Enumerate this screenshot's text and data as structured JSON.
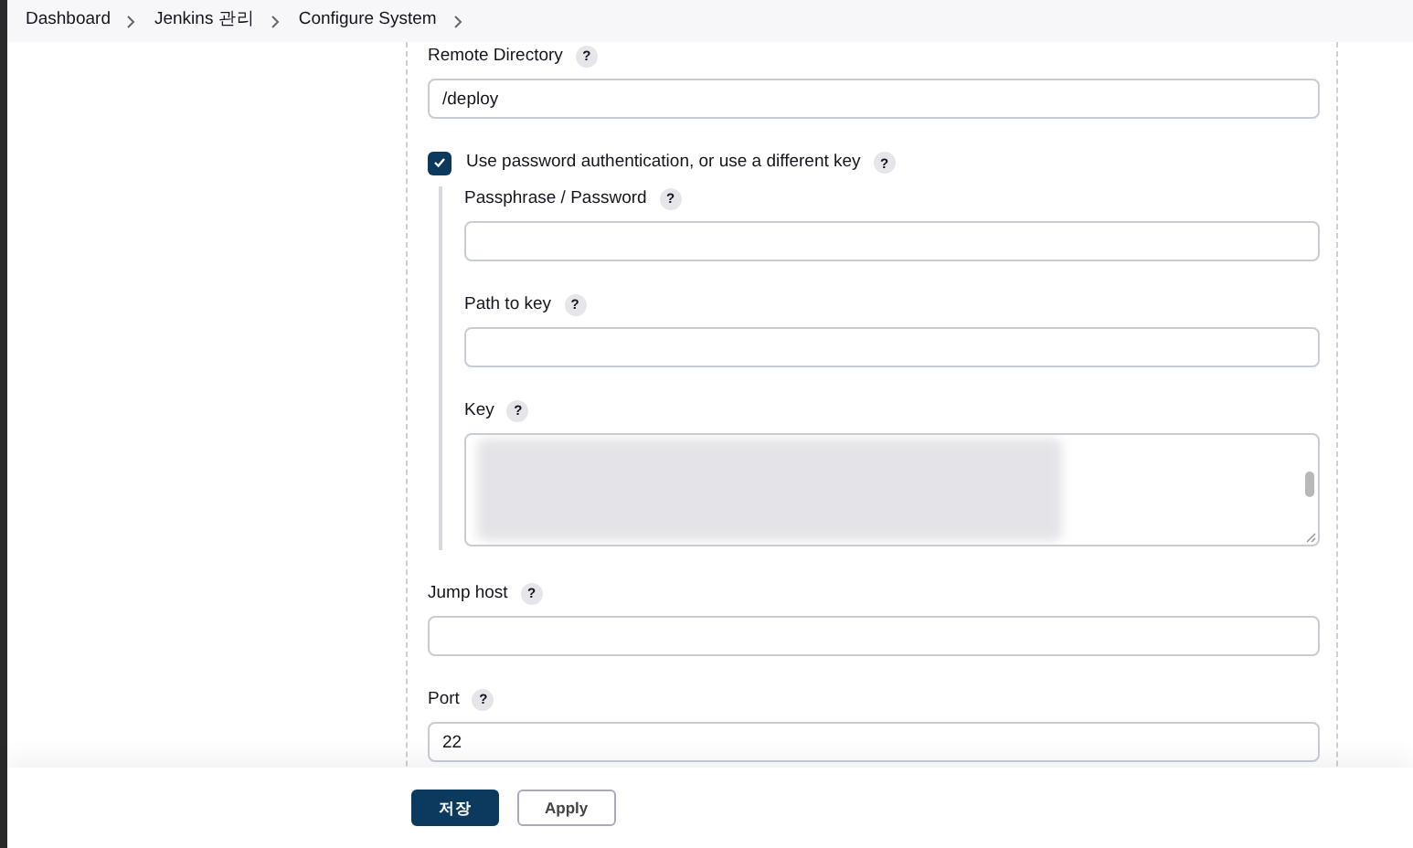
{
  "breadcrumbs": [
    {
      "label": "Dashboard"
    },
    {
      "label": "Jenkins 관리"
    },
    {
      "label": "Configure System"
    }
  ],
  "remote_directory": {
    "label": "Remote Directory",
    "help": "?",
    "value": "/deploy"
  },
  "password_auth": {
    "label": "Use password authentication, or use a different key",
    "help": "?",
    "checked": true,
    "fields": [
      {
        "kind": "input",
        "label": "Passphrase / Password",
        "help": "?"
      },
      {
        "kind": "input",
        "label": "Path to key",
        "help": "?"
      },
      {
        "kind": "textarea",
        "label": "Key",
        "help": "?"
      }
    ]
  },
  "fields": [
    {
      "label": "Jump host",
      "help": "?"
    },
    {
      "label": "Port",
      "help": "?",
      "value": "22"
    }
  ],
  "buttons": [
    {
      "label": "저장",
      "kind": "primary"
    },
    {
      "label": "Apply",
      "kind": "secondary"
    }
  ]
}
